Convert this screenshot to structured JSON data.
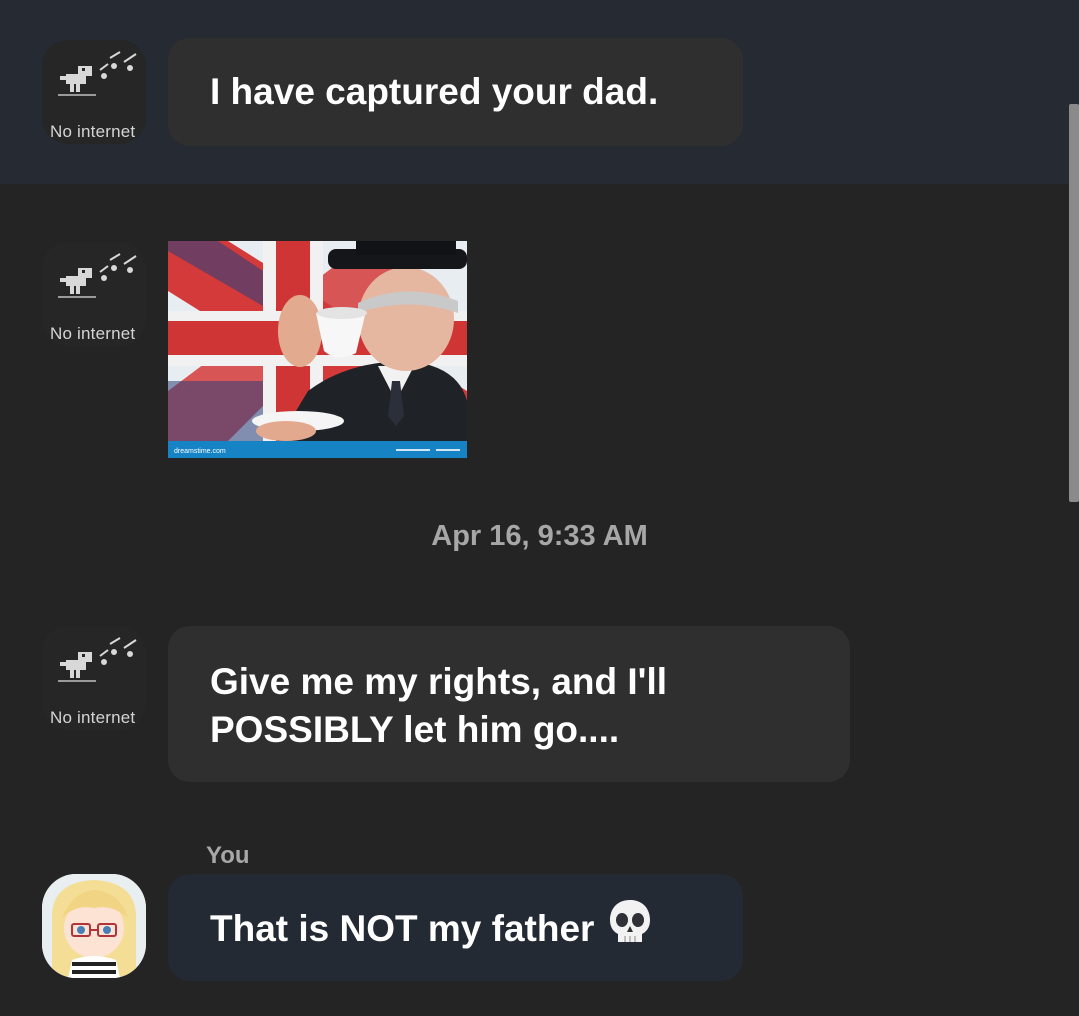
{
  "messages": [
    {
      "sender_label": "No internet",
      "text": "I have captured your dad."
    },
    {
      "sender_label": "No internet",
      "image_alt": "dreamstime.com"
    },
    {
      "sender_label": "No internet",
      "line1": "Give me my rights, and I'll",
      "line2": "POSSIBLY let him go...."
    }
  ],
  "timestamp": "Apr 16, 9:33 AM",
  "you": {
    "label": "You",
    "text": "That is NOT my father",
    "emoji_icon": "skull-icon"
  },
  "photo": {
    "watermark": "dreamstime.com"
  },
  "colors": {
    "background": "#242424",
    "highlight": "#252a33",
    "bubble": "#2f2f2f",
    "my_bubble": "#232a34",
    "text": "#ffffff",
    "muted": "#a7a7a7"
  }
}
